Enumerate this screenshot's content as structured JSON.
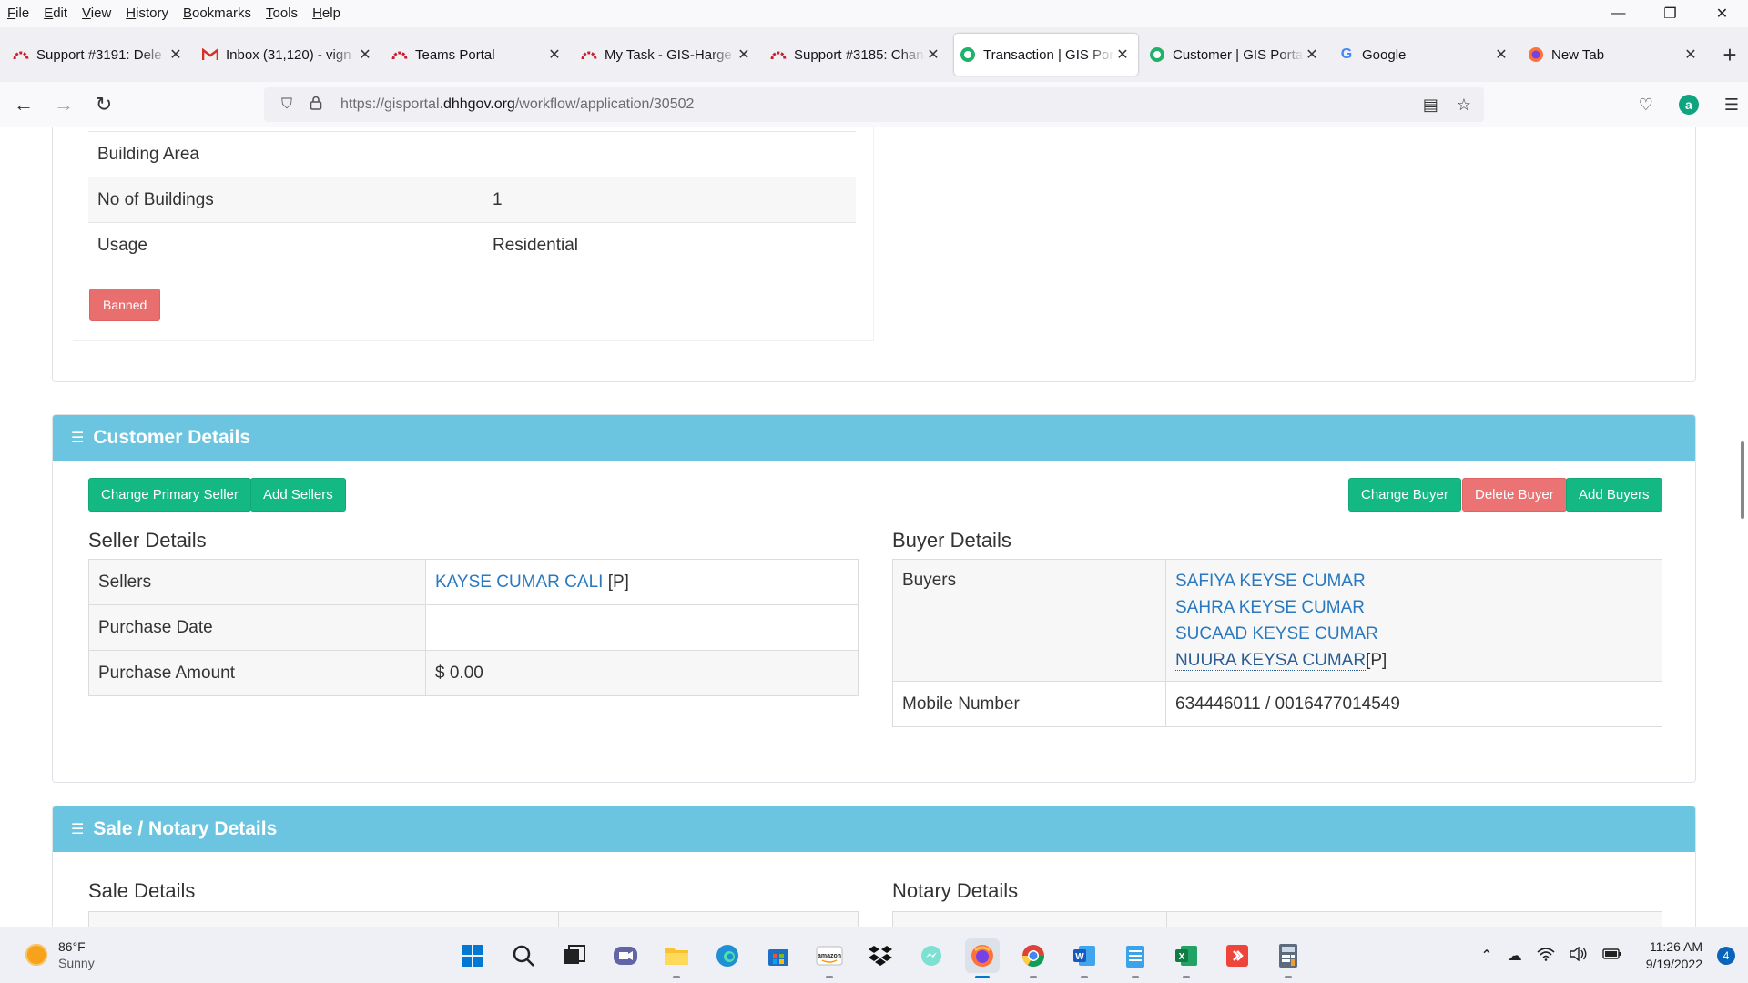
{
  "menu": [
    "File",
    "Edit",
    "View",
    "History",
    "Bookmarks",
    "Tools",
    "Help"
  ],
  "menu_underline": [
    "F",
    "E",
    "V",
    "H",
    "B",
    "T",
    "H"
  ],
  "window_controls": [
    "minimize-icon",
    "restore-icon",
    "close-icon"
  ],
  "tabs": [
    {
      "title": "Support #3191: Dele",
      "icon": "redmine-icon",
      "color": "#c8202f"
    },
    {
      "title": "Inbox (31,120) - vign",
      "icon": "gmail-icon",
      "color": "#d93025"
    },
    {
      "title": "Teams Portal",
      "icon": "redmine-icon",
      "color": "#c8202f"
    },
    {
      "title": "My Task - GIS-Harge",
      "icon": "redmine-icon",
      "color": "#c8202f"
    },
    {
      "title": "Support #3185: Chan",
      "icon": "redmine-icon",
      "color": "#c8202f"
    },
    {
      "title": "Transaction | GIS Por",
      "icon": "gis-icon",
      "color": "#20b26b",
      "active": true
    },
    {
      "title": "Customer | GIS Portal",
      "icon": "gis-icon",
      "color": "#20b26b"
    },
    {
      "title": "Google",
      "icon": "google-icon",
      "color": "#4285f4"
    },
    {
      "title": "New Tab",
      "icon": "firefox-icon",
      "color": "#ff7139"
    }
  ],
  "url": {
    "prefix": "https://gisportal.",
    "domain": "dhhgov.org",
    "path": "/workflow/application/30502"
  },
  "property": {
    "rows": [
      {
        "label": "Building Area",
        "value": ""
      },
      {
        "label": "No of Buildings",
        "value": "1"
      },
      {
        "label": "Usage",
        "value": "Residential"
      }
    ],
    "status_badge": "Banned"
  },
  "customer": {
    "heading": "Customer Details",
    "buttons": {
      "change_primary_seller": "Change Primary Seller",
      "add_sellers": "Add Sellers",
      "change_buyer": "Change Buyer",
      "delete_buyer": "Delete Buyer",
      "add_buyers": "Add Buyers"
    },
    "seller": {
      "title": "Seller Details",
      "sellers_label": "Sellers",
      "seller_name": "KAYSE CUMAR CALI",
      "primary_tag": "[P]",
      "purchase_date_label": "Purchase Date",
      "purchase_date": "",
      "purchase_amount_label": "Purchase Amount",
      "purchase_amount": "$ 0.00"
    },
    "buyer": {
      "title": "Buyer Details",
      "buyers_label": "Buyers",
      "names": [
        "SAFIYA KEYSE CUMAR",
        "SAHRA KEYSE CUMAR",
        "SUCAAD KEYSE CUMAR",
        "NUURA KEYSA CUMAR"
      ],
      "primary_tag": "[P]",
      "mobile_label": "Mobile Number",
      "mobile": "634446011 / 0016477014549"
    }
  },
  "sale": {
    "heading": "Sale / Notary Details",
    "sale_title": "Sale Details",
    "notary_title": "Notary Details"
  },
  "taskbar": {
    "temperature": "86°F",
    "condition": "Sunny",
    "time": "11:26 AM",
    "date": "9/19/2022",
    "notifications": "4"
  },
  "colors": {
    "panel_header": "#6cc5e0",
    "btn_green": "#14b883",
    "btn_red": "#ec7373",
    "link": "#2a79c0"
  }
}
